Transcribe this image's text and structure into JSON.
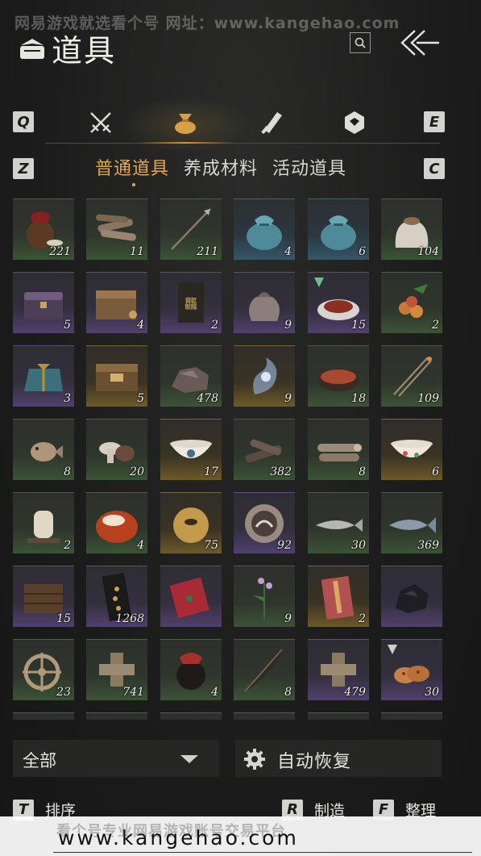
{
  "watermark_top": "网易游戏就选看个号  网址：www.kangehao.com",
  "header": {
    "title": "道具"
  },
  "hotkeys": {
    "prev_category": "Q",
    "next_category": "E",
    "prev_tab": "Z",
    "next_tab": "C"
  },
  "categories": [
    "weapons-icon",
    "item-bag-icon",
    "scroll-icon",
    "gem-icon"
  ],
  "active_category": "item-bag-icon",
  "subtabs": [
    {
      "label": "普通道具",
      "active": true
    },
    {
      "label": "养成材料",
      "active": false
    },
    {
      "label": "活动道具",
      "active": false
    }
  ],
  "items": [
    {
      "name": "wine-jar-icon",
      "count": "221",
      "rarity": "green"
    },
    {
      "name": "firewood-icon",
      "count": "11",
      "rarity": "green"
    },
    {
      "name": "arrow-icon",
      "count": "211",
      "rarity": "green"
    },
    {
      "name": "blue-pouch-icon",
      "count": "4",
      "rarity": "blue"
    },
    {
      "name": "blue-pouch-icon",
      "count": "6",
      "rarity": "blue"
    },
    {
      "name": "grain-sack-icon",
      "count": "104",
      "rarity": "green"
    },
    {
      "name": "chest-icon",
      "count": "5",
      "rarity": "purple"
    },
    {
      "name": "wooden-box-icon",
      "count": "4",
      "rarity": "purple"
    },
    {
      "name": "scripture-book-icon",
      "count": "2",
      "rarity": "purple"
    },
    {
      "name": "cloth-pouch-icon",
      "count": "9",
      "rarity": "purple"
    },
    {
      "name": "braised-dish-icon",
      "count": "15",
      "rarity": "purple"
    },
    {
      "name": "lychee-icon",
      "count": "2",
      "rarity": "green"
    },
    {
      "name": "gift-bundle-icon",
      "count": "3",
      "rarity": "purple"
    },
    {
      "name": "ornate-chest-icon",
      "count": "5",
      "rarity": "gold"
    },
    {
      "name": "ore-stone-icon",
      "count": "478",
      "rarity": "green"
    },
    {
      "name": "spirit-essence-icon",
      "count": "9",
      "rarity": "gold"
    },
    {
      "name": "hotpot-dish-icon",
      "count": "18",
      "rarity": "green"
    },
    {
      "name": "fire-arrow-icon",
      "count": "109",
      "rarity": "green"
    },
    {
      "name": "pufferfish-icon",
      "count": "8",
      "rarity": "green"
    },
    {
      "name": "mushroom-icon",
      "count": "20",
      "rarity": "green"
    },
    {
      "name": "porcelain-bowl-icon",
      "count": "17",
      "rarity": "gold"
    },
    {
      "name": "charcoal-wood-icon",
      "count": "382",
      "rarity": "green"
    },
    {
      "name": "log-pile-icon",
      "count": "8",
      "rarity": "green"
    },
    {
      "name": "flower-bowl-icon",
      "count": "6",
      "rarity": "gold"
    },
    {
      "name": "jar-icon",
      "count": "2",
      "rarity": "green"
    },
    {
      "name": "red-jade-icon",
      "count": "4",
      "rarity": "green"
    },
    {
      "name": "gold-bell-icon",
      "count": "75",
      "rarity": "gold"
    },
    {
      "name": "crane-medal-icon",
      "count": "92",
      "rarity": "purple"
    },
    {
      "name": "fish-icon",
      "count": "30",
      "rarity": "green"
    },
    {
      "name": "mackerel-icon",
      "count": "369",
      "rarity": "green"
    },
    {
      "name": "wooden-rack-icon",
      "count": "15",
      "rarity": "purple"
    },
    {
      "name": "gold-tablet-icon",
      "count": "1268",
      "rarity": "purple"
    },
    {
      "name": "red-envelope-icon",
      "count": "",
      "rarity": "purple"
    },
    {
      "name": "flower-herb-icon",
      "count": "9",
      "rarity": "green"
    },
    {
      "name": "red-letter-icon",
      "count": "2",
      "rarity": "gold"
    },
    {
      "name": "black-ore-icon",
      "count": "",
      "rarity": "purple"
    },
    {
      "name": "ship-wheel-icon",
      "count": "23",
      "rarity": "green"
    },
    {
      "name": "stone-block-icon",
      "count": "741",
      "rarity": "green"
    },
    {
      "name": "red-jar-icon",
      "count": "4",
      "rarity": "green"
    },
    {
      "name": "feather-quill-icon",
      "count": "8",
      "rarity": "green"
    },
    {
      "name": "stone-block-icon",
      "count": "479",
      "rarity": "purple"
    },
    {
      "name": "pastry-icon",
      "count": "30",
      "rarity": "purple"
    }
  ],
  "filter": {
    "label": "全部"
  },
  "auto_recover": {
    "label": "自动恢复"
  },
  "actions": [
    {
      "key": "T",
      "label": "排序"
    },
    {
      "key": "R",
      "label": "制造"
    },
    {
      "key": "F",
      "label": "整理"
    }
  ],
  "banner": {
    "faint_text": "看个号专业网易游戏账号交易平台",
    "url": "www.kangehao.com"
  },
  "colors": {
    "accent": "#e0a857",
    "text": "#e6e4de",
    "background": "#1b1c1b"
  }
}
